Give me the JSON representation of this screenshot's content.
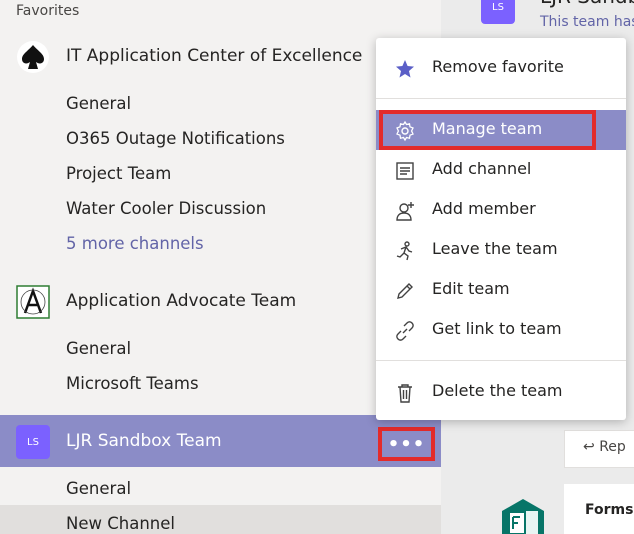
{
  "sidebar": {
    "favorites_label": "Favorites",
    "teams": [
      {
        "name": "IT Application Center of Excellence",
        "icon": "spade-logo-icon",
        "channels": [
          "General",
          "O365 Outage Notifications",
          "Project Team",
          "Water Cooler Discussion"
        ],
        "more_channels": "5 more channels"
      },
      {
        "name": "Application Advocate Team",
        "icon": "letter-a-logo-icon",
        "channels": [
          "General",
          "Microsoft Teams"
        ]
      },
      {
        "name": "LJR Sandbox Team",
        "avatar_text": "LS",
        "more_options_label": "•••",
        "channels": [
          "General",
          "New Channel"
        ]
      }
    ]
  },
  "context_menu": {
    "items": [
      {
        "label": "Remove favorite",
        "icon": "star-icon"
      },
      {
        "label": "Manage team",
        "icon": "gear-icon"
      },
      {
        "label": "Add channel",
        "icon": "channel-list-icon"
      },
      {
        "label": "Add member",
        "icon": "add-person-icon"
      },
      {
        "label": "Leave the team",
        "icon": "running-person-icon"
      },
      {
        "label": "Edit team",
        "icon": "pencil-icon"
      },
      {
        "label": "Get link to team",
        "icon": "link-icon"
      },
      {
        "label": "Delete the team",
        "icon": "trash-icon"
      }
    ]
  },
  "content_panel": {
    "avatar_text": "LS",
    "title": "LJR Sandb",
    "subtitle": "This team has",
    "reply_label": "Rep",
    "forms_label": "Forms"
  },
  "colors": {
    "accent": "#6264a7",
    "selected_bg": "#8b8cc7",
    "annotation_red": "#e32b2b",
    "avatar_purple": "#7b61ff"
  }
}
